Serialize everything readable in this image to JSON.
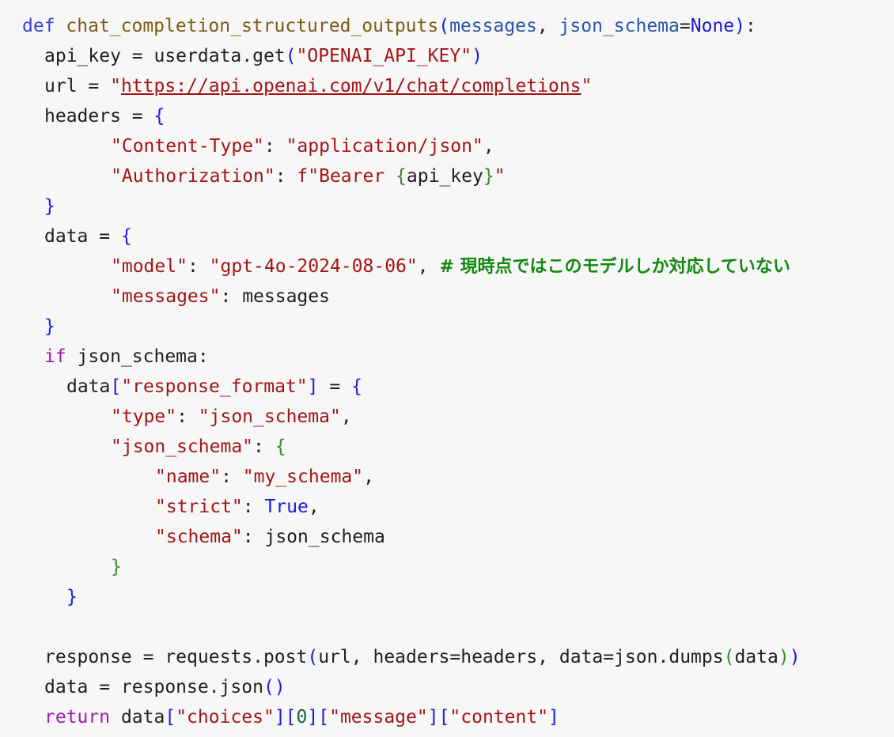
{
  "code": {
    "func_name": "chat_completion_structured_outputs",
    "param_messages": "messages",
    "param_json_schema": "json_schema",
    "none_value": "None",
    "api_key_var": "api_key",
    "userdata_call": "userdata.get",
    "api_key_name": "\"OPENAI_API_KEY\"",
    "url_var": "url",
    "url_value": "https://api.openai.com/v1/chat/completions",
    "headers_var": "headers",
    "content_type_key": "\"Content-Type\"",
    "content_type_value": "\"application/json\"",
    "authorization_key": "\"Authorization\"",
    "authorization_prefix": "f\"Bearer ",
    "authorization_inner": "api_key",
    "data_var": "data",
    "model_key": "\"model\"",
    "model_value": "\"gpt-4o-2024-08-06\"",
    "model_comment": "# 現時点ではこのモデルしか対応していない",
    "messages_key": "\"messages\"",
    "messages_value": "messages",
    "if_keyword": "if",
    "if_condition": "json_schema:",
    "response_format_key": "\"response_format\"",
    "type_key": "\"type\"",
    "type_value": "\"json_schema\"",
    "json_schema_key": "\"json_schema\"",
    "name_key": "\"name\"",
    "name_value": "\"my_schema\"",
    "strict_key": "\"strict\"",
    "strict_value": "True",
    "schema_key": "\"schema\"",
    "schema_value": "json_schema",
    "response_var": "response",
    "requests_post": "requests.post",
    "post_args_url": "url",
    "post_args_headers": "headers=headers",
    "post_args_data": "data=json.dumps",
    "post_args_inner": "data",
    "response_json": "response.json",
    "return_keyword": "return",
    "choices_key": "\"choices\"",
    "index_zero": "0",
    "message_key": "\"message\"",
    "content_key": "\"content\""
  }
}
